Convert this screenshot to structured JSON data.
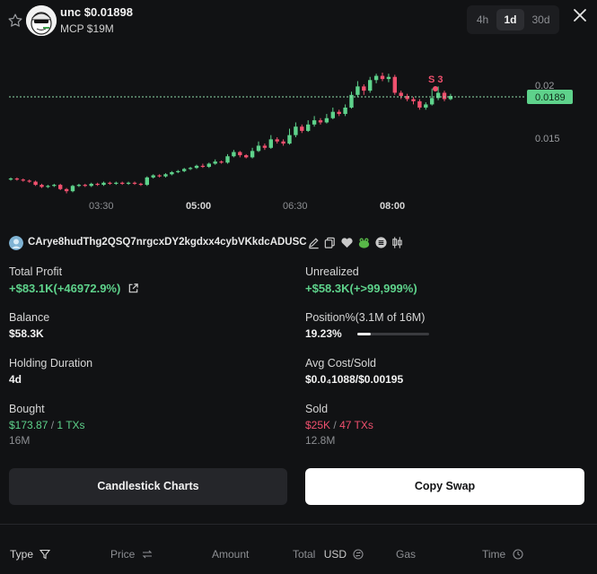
{
  "header": {
    "token_name": "unc $0.01898",
    "mcp": "MCP $19M",
    "timeframes": [
      "4h",
      "1d",
      "30d"
    ],
    "active_timeframe": "1d"
  },
  "chart": {
    "y_ticks": [
      "0.02",
      "0.015"
    ],
    "current_price": "0.0189",
    "x_ticks": [
      "03:30",
      "05:00",
      "06:30",
      "08:00"
    ],
    "bold_x_ticks": [
      "05:00",
      "08:00"
    ],
    "marker": "S 3",
    "colors": {
      "up": "#5ed28b",
      "down": "#f0506e",
      "price_tag": "#5ed28b"
    }
  },
  "chart_data": {
    "type": "candlestick",
    "x_ticks": [
      "03:30",
      "05:00",
      "06:30",
      "08:00"
    ],
    "y_ticks": [
      "0.02",
      "0.015"
    ],
    "current_price": 0.0189,
    "candles": [
      [
        0.011,
        0.0111,
        0.0112,
        0.0109
      ],
      [
        0.0111,
        0.011,
        0.0112,
        0.0109
      ],
      [
        0.011,
        0.0109,
        0.0111,
        0.0108
      ],
      [
        0.0109,
        0.0108,
        0.011,
        0.0107
      ],
      [
        0.0108,
        0.0105,
        0.0109,
        0.0104
      ],
      [
        0.0105,
        0.0103,
        0.0106,
        0.0102
      ],
      [
        0.0103,
        0.0104,
        0.0105,
        0.0102
      ],
      [
        0.0104,
        0.0105,
        0.0106,
        0.0103
      ],
      [
        0.0105,
        0.0101,
        0.0106,
        0.01
      ],
      [
        0.0101,
        0.0099,
        0.0102,
        0.0097
      ],
      [
        0.0099,
        0.0104,
        0.0105,
        0.0098
      ],
      [
        0.0104,
        0.0105,
        0.0106,
        0.0103
      ],
      [
        0.0105,
        0.0104,
        0.0106,
        0.0103
      ],
      [
        0.0104,
        0.0106,
        0.0107,
        0.0103
      ],
      [
        0.0106,
        0.0105,
        0.0107,
        0.0104
      ],
      [
        0.0105,
        0.0107,
        0.0108,
        0.0104
      ],
      [
        0.0107,
        0.0106,
        0.0108,
        0.0105
      ],
      [
        0.0106,
        0.0107,
        0.0108,
        0.0105
      ],
      [
        0.0107,
        0.0106,
        0.0108,
        0.0105
      ],
      [
        0.0106,
        0.0107,
        0.0108,
        0.0105
      ],
      [
        0.0107,
        0.0106,
        0.0108,
        0.0105
      ],
      [
        0.0106,
        0.0105,
        0.0107,
        0.0104
      ],
      [
        0.0105,
        0.0112,
        0.0113,
        0.0104
      ],
      [
        0.0112,
        0.0114,
        0.0115,
        0.0111
      ],
      [
        0.0114,
        0.0113,
        0.0115,
        0.0112
      ],
      [
        0.0113,
        0.0115,
        0.0116,
        0.0112
      ],
      [
        0.0115,
        0.0117,
        0.0118,
        0.0114
      ],
      [
        0.0117,
        0.0118,
        0.0119,
        0.0116
      ],
      [
        0.0118,
        0.012,
        0.0121,
        0.0117
      ],
      [
        0.012,
        0.0121,
        0.0122,
        0.0119
      ],
      [
        0.0121,
        0.0123,
        0.0124,
        0.012
      ],
      [
        0.0123,
        0.0122,
        0.0125,
        0.0121
      ],
      [
        0.0122,
        0.0125,
        0.0126,
        0.0121
      ],
      [
        0.0125,
        0.0127,
        0.0129,
        0.0124
      ],
      [
        0.0127,
        0.0126,
        0.0128,
        0.0125
      ],
      [
        0.0126,
        0.0132,
        0.0134,
        0.0125
      ],
      [
        0.0132,
        0.0136,
        0.0138,
        0.0131
      ],
      [
        0.0136,
        0.0133,
        0.0137,
        0.0131
      ],
      [
        0.0133,
        0.0131,
        0.0134,
        0.013
      ],
      [
        0.0131,
        0.0137,
        0.014,
        0.013
      ],
      [
        0.0137,
        0.0142,
        0.0146,
        0.0136
      ],
      [
        0.0142,
        0.014,
        0.0144,
        0.0138
      ],
      [
        0.014,
        0.0148,
        0.0152,
        0.0139
      ],
      [
        0.0148,
        0.0146,
        0.015,
        0.0144
      ],
      [
        0.0146,
        0.0144,
        0.0148,
        0.0142
      ],
      [
        0.0144,
        0.0152,
        0.0158,
        0.0143
      ],
      [
        0.0152,
        0.016,
        0.0164,
        0.015
      ],
      [
        0.016,
        0.0156,
        0.0162,
        0.0154
      ],
      [
        0.0156,
        0.0162,
        0.0166,
        0.0155
      ],
      [
        0.0162,
        0.0166,
        0.017,
        0.016
      ],
      [
        0.0166,
        0.0164,
        0.0168,
        0.0162
      ],
      [
        0.0164,
        0.0168,
        0.0172,
        0.0163
      ],
      [
        0.0168,
        0.0174,
        0.0178,
        0.0167
      ],
      [
        0.0174,
        0.0172,
        0.0176,
        0.017
      ],
      [
        0.0172,
        0.0178,
        0.0181,
        0.017
      ],
      [
        0.0178,
        0.019,
        0.0193,
        0.0177
      ],
      [
        0.019,
        0.0198,
        0.0203,
        0.0188
      ],
      [
        0.0198,
        0.0194,
        0.02,
        0.019
      ],
      [
        0.0194,
        0.0204,
        0.0207,
        0.0192
      ],
      [
        0.0204,
        0.0208,
        0.021,
        0.0201
      ],
      [
        0.0208,
        0.0205,
        0.0211,
        0.0203
      ],
      [
        0.0205,
        0.0207,
        0.021,
        0.0202
      ],
      [
        0.0207,
        0.0192,
        0.0209,
        0.019
      ],
      [
        0.0192,
        0.0189,
        0.0194,
        0.0186
      ],
      [
        0.0189,
        0.0186,
        0.0191,
        0.0184
      ],
      [
        0.0186,
        0.0184,
        0.0188,
        0.0181
      ],
      [
        0.0184,
        0.0178,
        0.0186,
        0.0176
      ],
      [
        0.0178,
        0.0181,
        0.0183,
        0.0176
      ],
      [
        0.0181,
        0.0187,
        0.0196,
        0.018
      ],
      [
        0.0187,
        0.0192,
        0.0198,
        0.0185
      ],
      [
        0.0192,
        0.0186,
        0.0194,
        0.0184
      ],
      [
        0.0186,
        0.0189,
        0.0191,
        0.0185
      ]
    ]
  },
  "wallet": {
    "address": "CArye8hudThg2QSQ7nrgcxDY2kgdxx4cybVKkdcADUSC"
  },
  "stats": {
    "total_profit": {
      "label": "Total Profit",
      "value": "+$83.1K(+46972.9%)"
    },
    "unrealized": {
      "label": "Unrealized",
      "value": "+$58.3K(+>99,999%)"
    },
    "balance": {
      "label": "Balance",
      "value": "$58.3K"
    },
    "position": {
      "label": "Position%(3.1M of 16M)",
      "value": "19.23%",
      "fraction": 0.1923
    },
    "holding": {
      "label": "Holding Duration",
      "value": "4d"
    },
    "avg_cost": {
      "label": "Avg Cost/Sold",
      "value": "$0.0₄1088/$0.00195"
    },
    "bought": {
      "label": "Bought",
      "amount": "$173.87",
      "sep": "/",
      "txs": "1 TXs",
      "tokens": "16M"
    },
    "sold": {
      "label": "Sold",
      "amount": "$25K",
      "sep": "/",
      "txs": "47 TXs",
      "tokens": "12.8M"
    }
  },
  "buttons": {
    "candlestick": "Candlestick Charts",
    "copy_swap": "Copy Swap"
  },
  "table": {
    "headers": {
      "type": "Type",
      "price": "Price",
      "amount": "Amount",
      "total": "Total",
      "usd": "USD",
      "gas": "Gas",
      "time": "Time"
    }
  }
}
